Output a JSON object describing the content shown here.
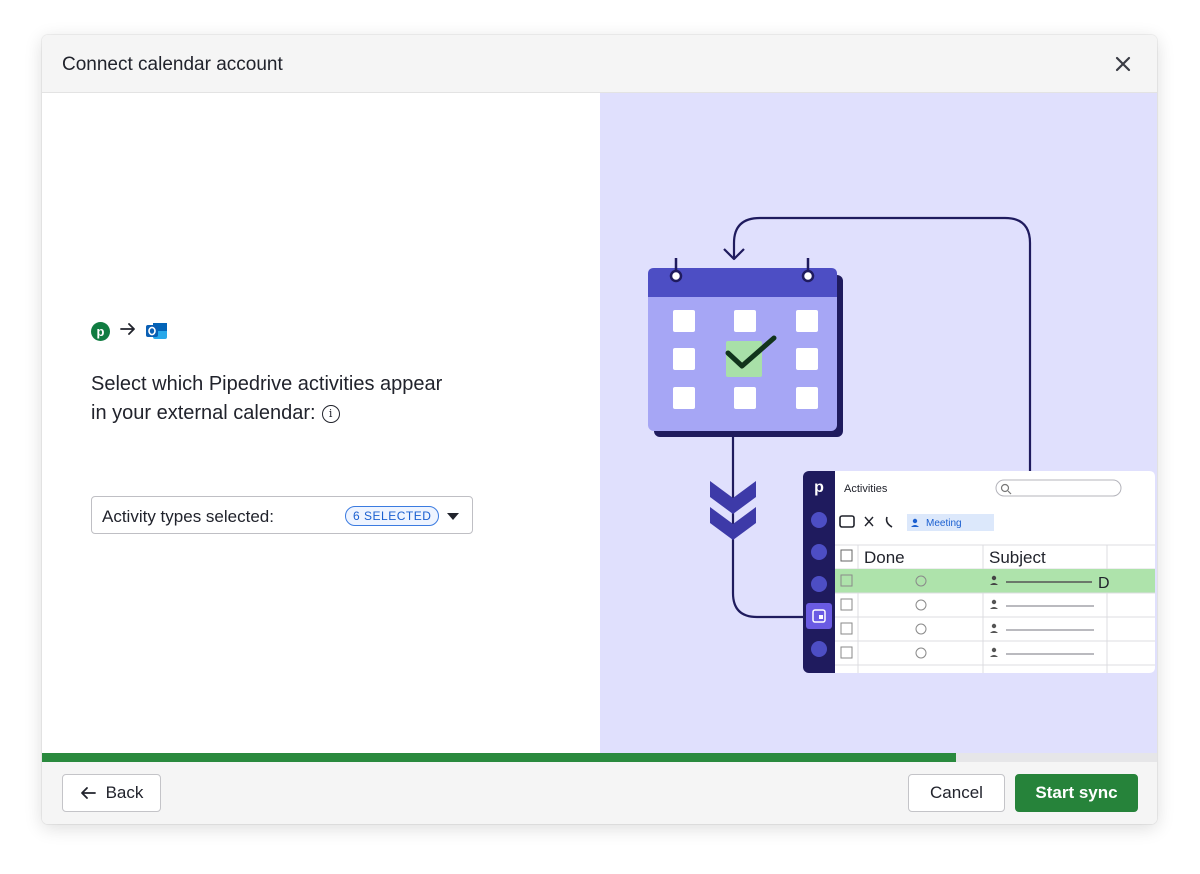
{
  "modal": {
    "title": "Connect calendar account"
  },
  "left": {
    "heading_line1": "Select which Pipedrive activities appear",
    "heading_line2": "in your external calendar:",
    "select_label": "Activity types selected:",
    "selected_badge": "6 SELECTED",
    "pipedrive_logo_letter": "p"
  },
  "illustration": {
    "app_letter": "p",
    "app_title": "Activities",
    "filter_chip": "Meeting",
    "columns": [
      "Done",
      "Subject"
    ],
    "row_partial_text": "D"
  },
  "progress": {
    "fraction": 0.82
  },
  "footer": {
    "back_label": "Back",
    "cancel_label": "Cancel",
    "start_label": "Start sync"
  },
  "colors": {
    "primary_green": "#26833a",
    "illustration_bg": "#e0e0fd",
    "calendar_purple": "#4d4ec4",
    "navy": "#1f1b5e"
  },
  "icons": [
    "close-icon",
    "pipedrive-logo-icon",
    "arrow-right-icon",
    "outlook-logo-icon",
    "info-icon",
    "chevron-down-icon",
    "arrow-left-icon",
    "search-icon"
  ]
}
